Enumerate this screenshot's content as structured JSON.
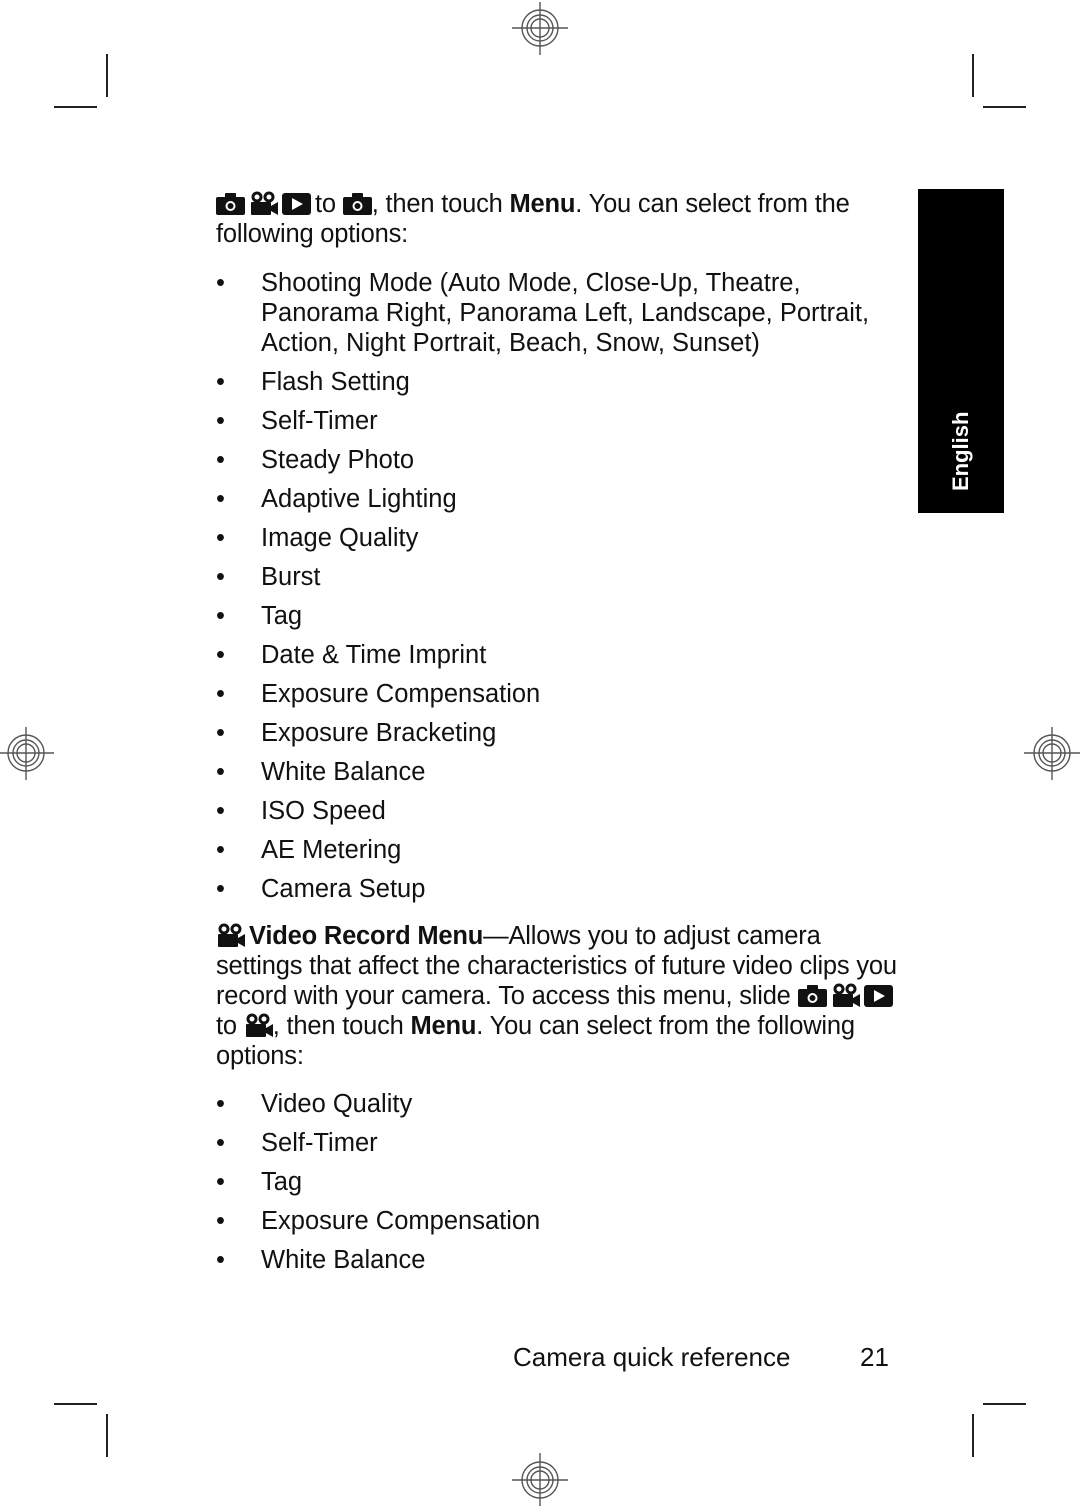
{
  "intro": {
    "text_to": "to",
    "text_then": ", then touch ",
    "menu_label": "Menu",
    "text_rest": ". You can select from the following options:"
  },
  "icons": {
    "camera": "camera-icon",
    "video": "video-camera-icon",
    "playback": "playback-icon"
  },
  "still_menu_options": [
    "Shooting Mode (Auto Mode, Close-Up, Theatre, Panorama Right, Panorama Left, Landscape, Portrait, Action, Night Portrait, Beach, Snow, Sunset)",
    "Flash Setting",
    "Self-Timer",
    "Steady Photo",
    "Adaptive Lighting",
    "Image Quality",
    "Burst",
    "Tag",
    "Date & Time Imprint",
    "Exposure Compensation",
    "Exposure Bracketing",
    "White Balance",
    "ISO Speed",
    "AE Metering",
    "Camera Setup"
  ],
  "video_section": {
    "title": "Video Record Menu",
    "desc": "—Allows you to adjust camera settings that affect the characteristics of future video clips you record with your camera. To access this menu, slide ",
    "text_to": "to",
    "text_then": ", then touch ",
    "menu_label": "Menu",
    "text_rest": ". You can select from the following options:"
  },
  "video_menu_options": [
    "Video Quality",
    "Self-Timer",
    "Tag",
    "Exposure Compensation",
    "White Balance"
  ],
  "bullet": "•",
  "side_tab": {
    "label": "English"
  },
  "footer": {
    "section": "Camera quick reference",
    "page_number": "21"
  }
}
